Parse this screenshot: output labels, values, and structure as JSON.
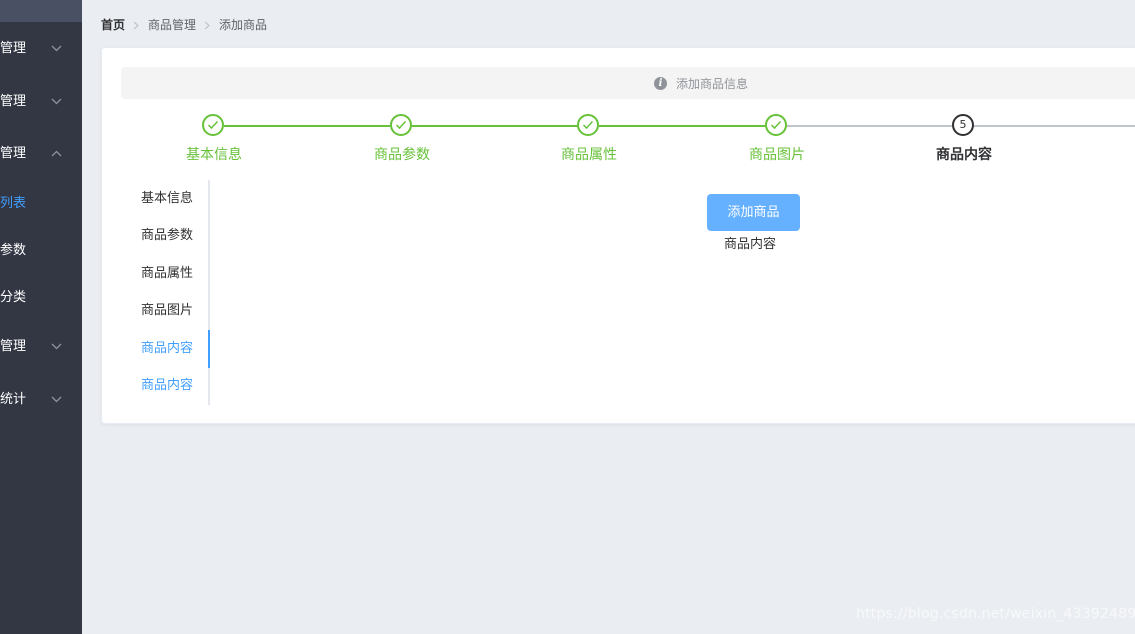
{
  "sidebar": {
    "menus": [
      {
        "label": "管理",
        "expanded": false
      },
      {
        "label": "管理",
        "expanded": false
      },
      {
        "label": "管理",
        "expanded": true
      },
      {
        "label": "管理",
        "expanded": false
      },
      {
        "label": "统计",
        "expanded": false
      }
    ],
    "submenus": [
      {
        "label": "列表",
        "active": true
      },
      {
        "label": "参数",
        "active": false
      },
      {
        "label": "分类",
        "active": false
      }
    ],
    "active_color": "#409eff",
    "background": "#333744"
  },
  "breadcrumb": {
    "home": "首页",
    "level1": "商品管理",
    "level2": "添加商品"
  },
  "alert": {
    "icon": "info-icon",
    "text": "添加商品信息"
  },
  "steps": {
    "active_index": 4,
    "items": [
      {
        "title": "基本信息",
        "status": "success"
      },
      {
        "title": "商品参数",
        "status": "success"
      },
      {
        "title": "商品属性",
        "status": "success"
      },
      {
        "title": "商品图片",
        "status": "success"
      },
      {
        "title": "商品内容",
        "status": "process",
        "number": "5"
      }
    ],
    "success_color": "#67c23a"
  },
  "tabs": {
    "items": [
      {
        "label": "基本信息"
      },
      {
        "label": "商品参数"
      },
      {
        "label": "商品属性"
      },
      {
        "label": "商品图片"
      },
      {
        "label": "商品内容"
      },
      {
        "label": "商品内容"
      }
    ],
    "active_index": 4
  },
  "content": {
    "add_button": "添加商品",
    "label": "商品内容"
  },
  "watermark": "https://blog.csdn.net/weixin_43392489"
}
